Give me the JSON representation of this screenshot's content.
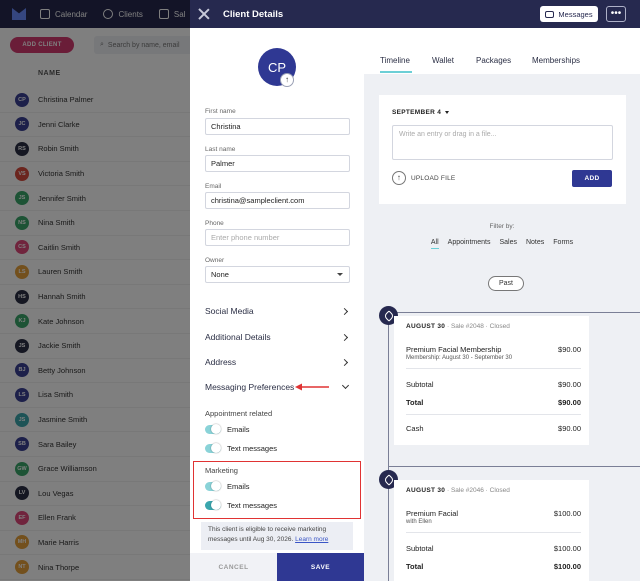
{
  "background": {
    "nav": [
      {
        "label": "Calendar",
        "icon": "calendar-icon"
      },
      {
        "label": "Clients",
        "icon": "clients-icon"
      },
      {
        "label": "Sal",
        "icon": "sales-icon"
      }
    ],
    "add_client": "ADD CLIENT",
    "search_placeholder": "Search by name, email",
    "column_name": "NAME",
    "clients": [
      {
        "initials": "CP",
        "name": "Christina Palmer",
        "color": "#3a4194"
      },
      {
        "initials": "JC",
        "name": "Jenni Clarke",
        "color": "#3a4194"
      },
      {
        "initials": "RS",
        "name": "Robin Smith",
        "color": "#2b2f45"
      },
      {
        "initials": "VS",
        "name": "Victoria Smith",
        "color": "#d64b3d"
      },
      {
        "initials": "JS",
        "name": "Jennifer Smith",
        "color": "#3aa66a"
      },
      {
        "initials": "NS",
        "name": "Nina Smith",
        "color": "#3aa66a"
      },
      {
        "initials": "CS",
        "name": "Caitlin Smith",
        "color": "#e0487a"
      },
      {
        "initials": "LS",
        "name": "Lauren Smith",
        "color": "#e6a13a"
      },
      {
        "initials": "HS",
        "name": "Hannah Smith",
        "color": "#2b2f45"
      },
      {
        "initials": "KJ",
        "name": "Kate Johnson",
        "color": "#3aa66a"
      },
      {
        "initials": "JS",
        "name": "Jackie Smith",
        "color": "#2b2f45"
      },
      {
        "initials": "BJ",
        "name": "Betty Johnson",
        "color": "#3a4194"
      },
      {
        "initials": "LS",
        "name": "Lisa Smith",
        "color": "#3a4194"
      },
      {
        "initials": "JS",
        "name": "Jasmine Smith",
        "color": "#3aa6ad"
      },
      {
        "initials": "SB",
        "name": "Sara Bailey",
        "color": "#3a4194"
      },
      {
        "initials": "GW",
        "name": "Grace Williamson",
        "color": "#3aa66a"
      },
      {
        "initials": "LV",
        "name": "Lou Vegas",
        "color": "#2b2f45"
      },
      {
        "initials": "EF",
        "name": "Ellen Frank",
        "color": "#e0487a"
      },
      {
        "initials": "MH",
        "name": "Marie Harris",
        "color": "#e6a13a"
      },
      {
        "initials": "NT",
        "name": "Nina Thorpe",
        "color": "#e6a13a"
      }
    ]
  },
  "drawer": {
    "title": "Client Details",
    "messages_button": "Messages",
    "more_button": "•••",
    "avatar_initials": "CP",
    "fields": {
      "first_name_label": "First name",
      "first_name": "Christina",
      "last_name_label": "Last name",
      "last_name": "Palmer",
      "email_label": "Email",
      "email": "christina@sampleclient.com",
      "phone_label": "Phone",
      "phone_placeholder": "Enter phone number",
      "owner_label": "Owner",
      "owner": "None"
    },
    "sections": [
      "Social Media",
      "Additional Details",
      "Address",
      "Messaging Preferences"
    ],
    "appointment_related": "Appointment related",
    "appt_emails": "Emails",
    "appt_texts": "Text messages",
    "marketing": "Marketing",
    "mkt_emails": "Emails",
    "mkt_texts": "Text messages",
    "eligible_text": "This client is eligible to receive marketing messages until Aug 30, 2026.",
    "learn_more": "Learn more",
    "cancel": "CANCEL",
    "save": "SAVE"
  },
  "timeline": {
    "tabs": [
      "Timeline",
      "Wallet",
      "Packages",
      "Memberships"
    ],
    "active_tab": "Timeline",
    "date": "SEPTEMBER 4",
    "entry_placeholder": "Write an entry or drag in a file...",
    "upload_file": "UPLOAD FILE",
    "add": "ADD",
    "filter_by": "Filter by:",
    "filters": [
      "All",
      "Appointments",
      "Sales",
      "Notes",
      "Forms"
    ],
    "past": "Past",
    "sales": [
      {
        "date": "AUGUST 30",
        "sale": "Sale #2048",
        "status": "Closed",
        "item": "Premium Facial Membership",
        "item_price": "$90.00",
        "item_sub": "Membership: August 30 - September 30",
        "subtotal_label": "Subtotal",
        "subtotal": "$90.00",
        "total_label": "Total",
        "total": "$90.00",
        "pay_label": "Cash",
        "pay": "$90.00"
      },
      {
        "date": "AUGUST 30",
        "sale": "Sale #2046",
        "status": "Closed",
        "item": "Premium Facial",
        "item_price": "$100.00",
        "item_sub": "with Ellen",
        "subtotal_label": "Subtotal",
        "subtotal": "$100.00",
        "total_label": "Total",
        "total": "$100.00"
      }
    ]
  },
  "colors": {
    "navy": "#26294f",
    "primary": "#2f3893",
    "accent_teal": "#6ccfd6",
    "highlight_red": "#e03333",
    "add_client_pink": "#d43a70"
  }
}
